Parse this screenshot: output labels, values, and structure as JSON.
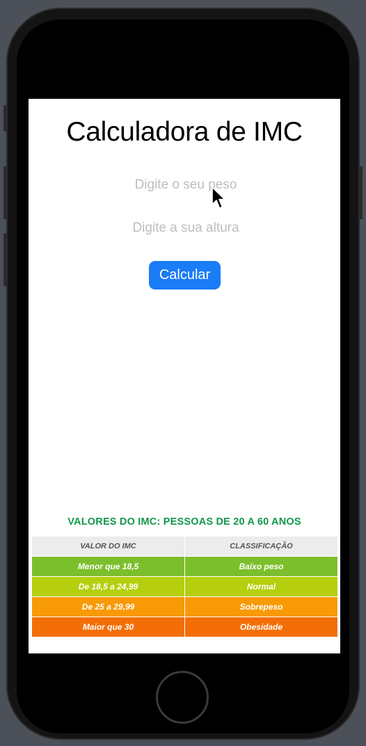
{
  "app": {
    "title": "Calculadora de IMC"
  },
  "form": {
    "peso_placeholder": "Digite o seu peso",
    "altura_placeholder": "Digite a sua altura",
    "calcular_label": "Calcular"
  },
  "imc_table": {
    "title": "VALORES DO IMC: PESSOAS DE 20 A 60 ANOS",
    "headers": [
      "VALOR DO IMC",
      "CLASSIFICAÇÃO"
    ],
    "rows": [
      {
        "valor": "Menor que 18,5",
        "classificacao": "Baixo peso",
        "color": "#7cbf2c"
      },
      {
        "valor": "De 18,5 a 24,99",
        "classificacao": "Normal",
        "color": "#b5cf0e"
      },
      {
        "valor": "De 25 a 29,99",
        "classificacao": "Sobrepeso",
        "color": "#f89a05"
      },
      {
        "valor": "Maior que 30",
        "classificacao": "Obesidade",
        "color": "#f36e06"
      }
    ]
  },
  "colors": {
    "accent": "#1a7cf7",
    "table_title": "#10974a"
  }
}
